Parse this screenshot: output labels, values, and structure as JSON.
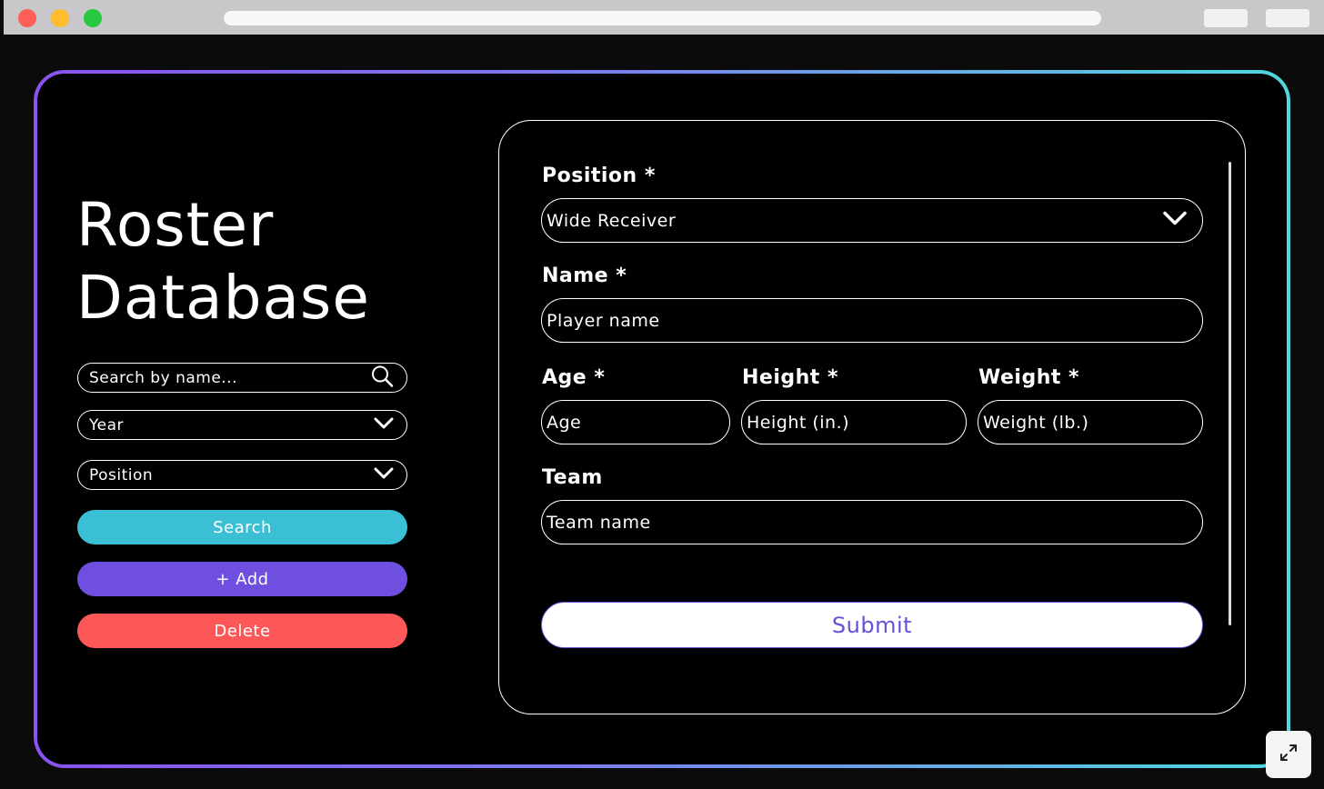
{
  "colors": {
    "gradient_start": "#8a52ef",
    "gradient_end": "#4fd8e0",
    "search_button": "#3bbfd4",
    "add_button": "#6f4fe0",
    "delete_button": "#fe5757",
    "submit_text": "#6a4fd9"
  },
  "sidebar": {
    "title_line1": "Roster",
    "title_line2": "Database",
    "search_placeholder": "Search by name...",
    "year_select": "Year",
    "position_select": "Position",
    "search_button": "Search",
    "add_button": "+ Add",
    "delete_button": "Delete"
  },
  "form": {
    "position_label": "Position *",
    "position_value": "Wide Receiver",
    "name_label": "Name *",
    "name_placeholder": "Player name",
    "age_label": "Age *",
    "age_placeholder": "Age",
    "height_label": "Height *",
    "height_placeholder": "Height (in.)",
    "weight_label": "Weight *",
    "weight_placeholder": "Weight (lb.)",
    "team_label": "Team",
    "team_placeholder": "Team name",
    "submit_button": "Submit"
  },
  "icons": {
    "search": "search-icon",
    "dropdown": "chevron-down-icon",
    "expand": "expand-icon"
  }
}
